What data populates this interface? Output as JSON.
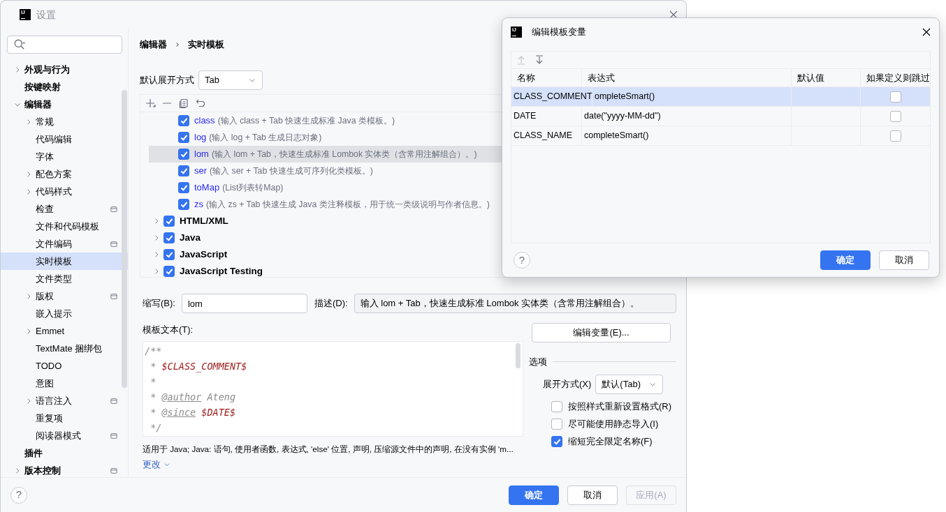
{
  "window": {
    "logo": "IJ",
    "title": "设置"
  },
  "sidebar": {
    "items": [
      {
        "label": "外观与行为",
        "bold": true,
        "expanded": false,
        "selected": false,
        "scoped": false
      },
      {
        "label": "按键映射",
        "bold": true,
        "selected": false,
        "scoped": false
      },
      {
        "label": "编辑器",
        "bold": true,
        "expanded": true,
        "selected": false,
        "scoped": false,
        "children": [
          {
            "label": "常规",
            "bold": false,
            "expanded": false,
            "selected": false,
            "scoped": false
          },
          {
            "label": "代码编辑",
            "bold": false,
            "selected": false,
            "scoped": false
          },
          {
            "label": "字体",
            "bold": false,
            "selected": false,
            "scoped": false
          },
          {
            "label": "配色方案",
            "bold": false,
            "expanded": false,
            "selected": false,
            "scoped": false
          },
          {
            "label": "代码样式",
            "bold": false,
            "expanded": false,
            "selected": false,
            "scoped": false
          },
          {
            "label": "检查",
            "bold": false,
            "selected": false,
            "scoped": true
          },
          {
            "label": "文件和代码模板",
            "bold": false,
            "selected": false,
            "scoped": false
          },
          {
            "label": "文件编码",
            "bold": false,
            "selected": false,
            "scoped": true
          },
          {
            "label": "实时模板",
            "bold": false,
            "selected": true,
            "scoped": false
          },
          {
            "label": "文件类型",
            "bold": false,
            "selected": false,
            "scoped": false
          },
          {
            "label": "版权",
            "bold": false,
            "expanded": false,
            "selected": false,
            "scoped": true
          },
          {
            "label": "嵌入提示",
            "bold": false,
            "selected": false,
            "scoped": false
          },
          {
            "label": "Emmet",
            "bold": false,
            "expanded": false,
            "selected": false,
            "scoped": false
          },
          {
            "label": "TextMate 捆绑包",
            "bold": false,
            "selected": false,
            "scoped": false
          },
          {
            "label": "TODO",
            "bold": false,
            "selected": false,
            "scoped": false
          },
          {
            "label": "意图",
            "bold": false,
            "selected": false,
            "scoped": false
          },
          {
            "label": "语言注入",
            "bold": false,
            "expanded": false,
            "selected": false,
            "scoped": true
          },
          {
            "label": "重复项",
            "bold": false,
            "selected": false,
            "scoped": false
          },
          {
            "label": "阅读器模式",
            "bold": false,
            "selected": false,
            "scoped": true
          }
        ]
      },
      {
        "label": "插件",
        "bold": true,
        "selected": false,
        "scoped": false
      },
      {
        "label": "版本控制",
        "bold": true,
        "expanded": false,
        "selected": false,
        "scoped": true
      }
    ]
  },
  "breadcrumb": [
    "编辑器",
    "实时模板"
  ],
  "default_expand": {
    "label": "默认展开方式",
    "value": "Tab"
  },
  "templates": [
    {
      "kind": "template",
      "name": "class",
      "description": "(输入 class + Tab 快速生成标准 Java 类模板。)",
      "checked": true,
      "selected": false
    },
    {
      "kind": "template",
      "name": "log",
      "description": "(输入 log + Tab 生成日志对象)",
      "checked": true,
      "selected": false
    },
    {
      "kind": "template",
      "name": "lom",
      "description": "(输入 lom + Tab，快速生成标准 Lombok 实体类（含常用注解组合）。)",
      "checked": true,
      "selected": true
    },
    {
      "kind": "template",
      "name": "ser",
      "description": "(输入 ser + Tab 快速生成可序列化类模板。)",
      "checked": true,
      "selected": false
    },
    {
      "kind": "template",
      "name": "toMap",
      "description": "(List列表转Map)",
      "checked": true,
      "selected": false
    },
    {
      "kind": "template",
      "name": "zs",
      "description": "(输入 zs + Tab 快速生成 Java 类注释模板，用于统一类级说明与作者信息。)",
      "checked": true,
      "selected": false
    },
    {
      "kind": "group",
      "name": "HTML/XML",
      "checked": true,
      "expanded": false,
      "selected": false
    },
    {
      "kind": "group",
      "name": "Java",
      "checked": true,
      "expanded": false,
      "selected": false
    },
    {
      "kind": "group",
      "name": "JavaScript",
      "checked": true,
      "expanded": false,
      "selected": false
    },
    {
      "kind": "group",
      "name": "JavaScript Testing",
      "checked": true,
      "expanded": false,
      "selected": false
    }
  ],
  "abbreviation": {
    "label": "缩写(B):",
    "value": "lom"
  },
  "description": {
    "label": "描述(D):",
    "value": "输入 lom + Tab，快速生成标准 Lombok 实体类（含常用注解组合）。"
  },
  "template_text": {
    "label": "模板文本(T):",
    "lines": [
      [
        {
          "kind": "comment",
          "text": "/**"
        }
      ],
      [
        {
          "kind": "comment",
          "text": " * "
        },
        {
          "kind": "variable",
          "text": "$CLASS_COMMENT$"
        }
      ],
      [
        {
          "kind": "comment",
          "text": " *"
        }
      ],
      [
        {
          "kind": "comment",
          "text": " * "
        },
        {
          "kind": "tag",
          "text": "@author"
        },
        {
          "kind": "comment",
          "text": " Ateng"
        }
      ],
      [
        {
          "kind": "comment",
          "text": " * "
        },
        {
          "kind": "tag",
          "text": "@since"
        },
        {
          "kind": "variable",
          "text": " $DATE$"
        }
      ],
      [
        {
          "kind": "comment",
          "text": " */"
        }
      ]
    ]
  },
  "applies_to": "适用于 Java; Java: 语句, 使用者函数, 表达式, 'else' 位置, 声明, 压缩源文件中的声明, 在没有实例 'm...",
  "change_link": "更改",
  "edit_variables_button": "编辑变量(E)...",
  "options": {
    "title": "选项",
    "expand_with": {
      "label": "展开方式(X)",
      "value": "默认(Tab)"
    },
    "checkboxes": [
      {
        "label": "按照样式重新设置格式(R)",
        "checked": false
      },
      {
        "label": "尽可能使用静态导入(I)",
        "checked": false
      },
      {
        "label": "缩短完全限定名称(F)",
        "checked": true
      }
    ]
  },
  "help_button": "?",
  "footer_buttons": [
    {
      "label": "确定",
      "kind": "primary",
      "disabled": false
    },
    {
      "label": "取消",
      "kind": "secondary",
      "disabled": false
    },
    {
      "label": "应用(A)",
      "kind": "secondary",
      "disabled": true
    }
  ],
  "dialog": {
    "logo": "IJ",
    "title": "编辑模板变量",
    "toolbar": [
      {
        "kind": "up",
        "disabled": true
      },
      {
        "kind": "down",
        "disabled": false
      }
    ],
    "columns": [
      "名称",
      "表达式",
      "默认值",
      "如果定义则跳过"
    ],
    "rows": [
      {
        "name": "CLASS_COMMENT",
        "expression": "ompleteSmart()",
        "skip_if_defined": false,
        "selected": true
      },
      {
        "name": "DATE",
        "expression": "date(\"yyyy-MM-dd\")",
        "skip_if_defined": false,
        "selected": false
      },
      {
        "name": "CLASS_NAME",
        "expression": "completeSmart()",
        "skip_if_defined": false,
        "selected": false
      }
    ],
    "help_button": "?",
    "buttons": [
      {
        "label": "确定",
        "kind": "primary"
      },
      {
        "label": "取消",
        "kind": "secondary"
      }
    ]
  }
}
